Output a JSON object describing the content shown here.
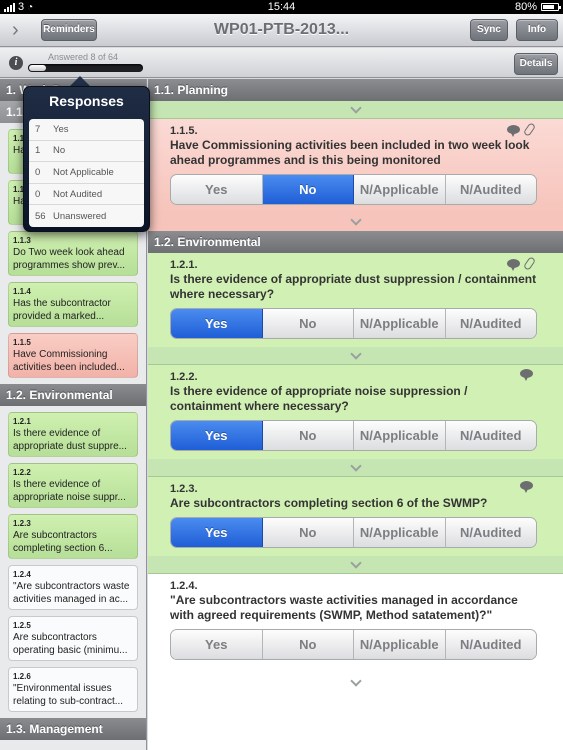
{
  "status_bar": {
    "carrier": "3",
    "time": "15:44",
    "battery": "80%"
  },
  "nav": {
    "reminders_label": "Reminders",
    "title": "WP01-PTB-2013...",
    "sync_label": "Sync",
    "info_label": "Info"
  },
  "progress": {
    "label": "Answered 8 of 64",
    "answered": 8,
    "total": 64,
    "details_label": "Details"
  },
  "popover": {
    "title": "Responses",
    "rows": [
      {
        "count": "7",
        "label": "Yes"
      },
      {
        "count": "1",
        "label": "No"
      },
      {
        "count": "0",
        "label": "Not Applicable"
      },
      {
        "count": "0",
        "label": "Not Audited"
      },
      {
        "count": "56",
        "label": "Unanswered"
      }
    ]
  },
  "sidebar": {
    "header": "1. Work Package",
    "sections": [
      {
        "title": "1.1. Planning",
        "items": [
          {
            "num": "1.1.1",
            "text": "Have ... ahead ...",
            "status": "green"
          },
          {
            "num": "1.1.2",
            "text": "Has ... pro...",
            "status": "green"
          },
          {
            "num": "1.1.3",
            "text": "Do Two week look ahead programmes show prev...",
            "status": "green"
          },
          {
            "num": "1.1.4",
            "text": "Has the subcontractor provided a marked...",
            "status": "green"
          },
          {
            "num": "1.1.5",
            "text": "Have Commissioning activities been included...",
            "status": "red"
          }
        ]
      },
      {
        "title": "1.2. Environmental",
        "items": [
          {
            "num": "1.2.1",
            "text": "Is there evidence of appropriate dust suppre...",
            "status": "green"
          },
          {
            "num": "1.2.2",
            "text": "Is there evidence of appropriate noise suppr...",
            "status": "green"
          },
          {
            "num": "1.2.3",
            "text": "Are subcontractors completing section 6...",
            "status": "green"
          },
          {
            "num": "1.2.4",
            "text": "\"Are subcontractors waste activities managed in ac...",
            "status": "white"
          },
          {
            "num": "1.2.5",
            "text": "Are subcontractors operating basic (minimu...",
            "status": "white"
          },
          {
            "num": "1.2.6",
            "text": "\"Environmental issues relating to sub-contract...",
            "status": "white"
          }
        ]
      },
      {
        "title": "1.3. Management",
        "items": []
      }
    ]
  },
  "main": {
    "sections": [
      {
        "title": "1.1. Planning",
        "questions": [
          {
            "num": "1.1.5.",
            "text": "Have Commissioning activities been included in two week look ahead programmes and is this being monitored",
            "selected": "No",
            "status": "red",
            "has_comment": true,
            "has_attachment": true
          }
        ]
      },
      {
        "title": "1.2. Environmental",
        "questions": [
          {
            "num": "1.2.1.",
            "text": "Is there evidence of appropriate dust suppression / containment where necessary?",
            "selected": "Yes",
            "status": "green",
            "has_comment": true,
            "has_attachment": true
          },
          {
            "num": "1.2.2.",
            "text": "Is there evidence of appropriate noise suppression / containment where necessary?",
            "selected": "Yes",
            "status": "green",
            "has_comment": true,
            "has_attachment": false
          },
          {
            "num": "1.2.3.",
            "text": "Are subcontractors completing section 6 of the SWMP?",
            "selected": "Yes",
            "status": "green",
            "has_comment": true,
            "has_attachment": false
          },
          {
            "num": "1.2.4.",
            "text": "\"Are subcontractors waste activities managed in accordance with agreed requirements (SWMP, Method satatement)?\"",
            "selected": "",
            "status": "white",
            "has_comment": false,
            "has_attachment": false
          }
        ]
      }
    ],
    "options": [
      "Yes",
      "No",
      "N/Applicable",
      "N/Audited"
    ]
  },
  "colors": {
    "selected_blue": "#1f5ed6",
    "green_answer": "#d1f0b4",
    "red_answer": "#f6c4bb"
  }
}
